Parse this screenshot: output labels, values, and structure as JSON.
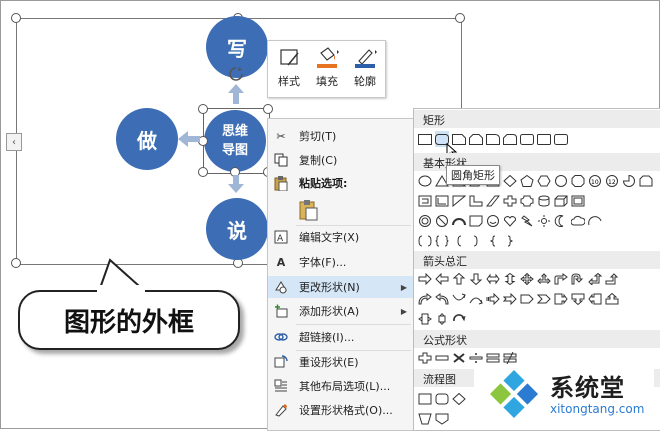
{
  "diagram": {
    "top": "写",
    "left": "做",
    "bottom": "说",
    "center_line1": "思维",
    "center_line2": "导图",
    "color": "#3d6eb5",
    "arrow_color": "#9fb6d6"
  },
  "mini_toolbar": {
    "style_label": "样式",
    "fill_label": "填充",
    "outline_label": "轮廓"
  },
  "callout": {
    "text": "图形的外框"
  },
  "side_tab": {
    "icon": "chevron-left-icon",
    "glyph": "‹"
  },
  "context_menu": {
    "items": [
      {
        "label": "剪切(T)",
        "icon": "scissors-icon"
      },
      {
        "label": "复制(C)",
        "icon": "copy-icon"
      },
      {
        "label": "粘贴选项:",
        "icon": "paste-icon"
      },
      {
        "label": "编辑文字(X)",
        "icon": "edit-text-icon"
      },
      {
        "label": "字体(F)...",
        "icon": "font-icon"
      },
      {
        "label": "更改形状(N)",
        "icon": "change-shape-icon"
      },
      {
        "label": "添加形状(A)",
        "icon": "add-shape-icon"
      },
      {
        "label": "超链接(I)...",
        "icon": "hyperlink-icon"
      },
      {
        "label": "重设形状(E)",
        "icon": "reset-shape-icon"
      },
      {
        "label": "其他布局选项(L)...",
        "icon": "layout-icon"
      },
      {
        "label": "设置形状格式(O)...",
        "icon": "format-shape-icon"
      }
    ]
  },
  "shape_gallery": {
    "sections": [
      "矩形",
      "基本形状",
      "箭头总汇",
      "公式形状",
      "流程图"
    ],
    "tooltip": "圆角矩形"
  },
  "watermark": {
    "title": "系统堂",
    "url": "xitongtang.com",
    "accent": "#2a7bd1"
  }
}
